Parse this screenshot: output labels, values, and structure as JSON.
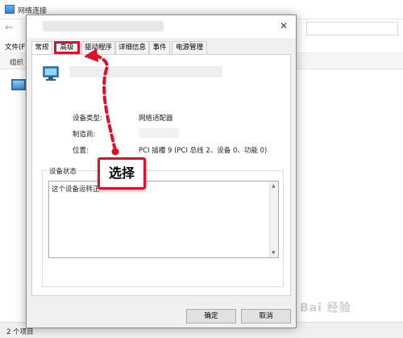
{
  "explorer": {
    "title": "网络连接",
    "menu_file": "文件(F",
    "cmd_organize": "组织",
    "status_items": "2 个项目"
  },
  "watermark": "Bai 经验",
  "dialog": {
    "tabs": [
      {
        "label": "常规"
      },
      {
        "label": "高级"
      },
      {
        "label": "驱动程序"
      },
      {
        "label": "详细信息"
      },
      {
        "label": "事件"
      },
      {
        "label": "电源管理"
      }
    ],
    "general": {
      "device_type_label": "设备类型:",
      "device_type_value": "网络适配器",
      "manufacturer_label": "制造商:",
      "location_label": "位置:",
      "location_value": "PCI 插槽 9 (PCI 总线 2、设备 0、功能 0)",
      "status_group_label": "设备状态",
      "status_text": "这个设备运转正"
    },
    "ok_label": "确定",
    "cancel_label": "取消"
  },
  "annotation": {
    "label": "选择",
    "color": "#e0102a",
    "highlighted_tab": "高级"
  },
  "icons": {
    "network_adapter": "network-adapter-icon",
    "close": "close-icon"
  }
}
